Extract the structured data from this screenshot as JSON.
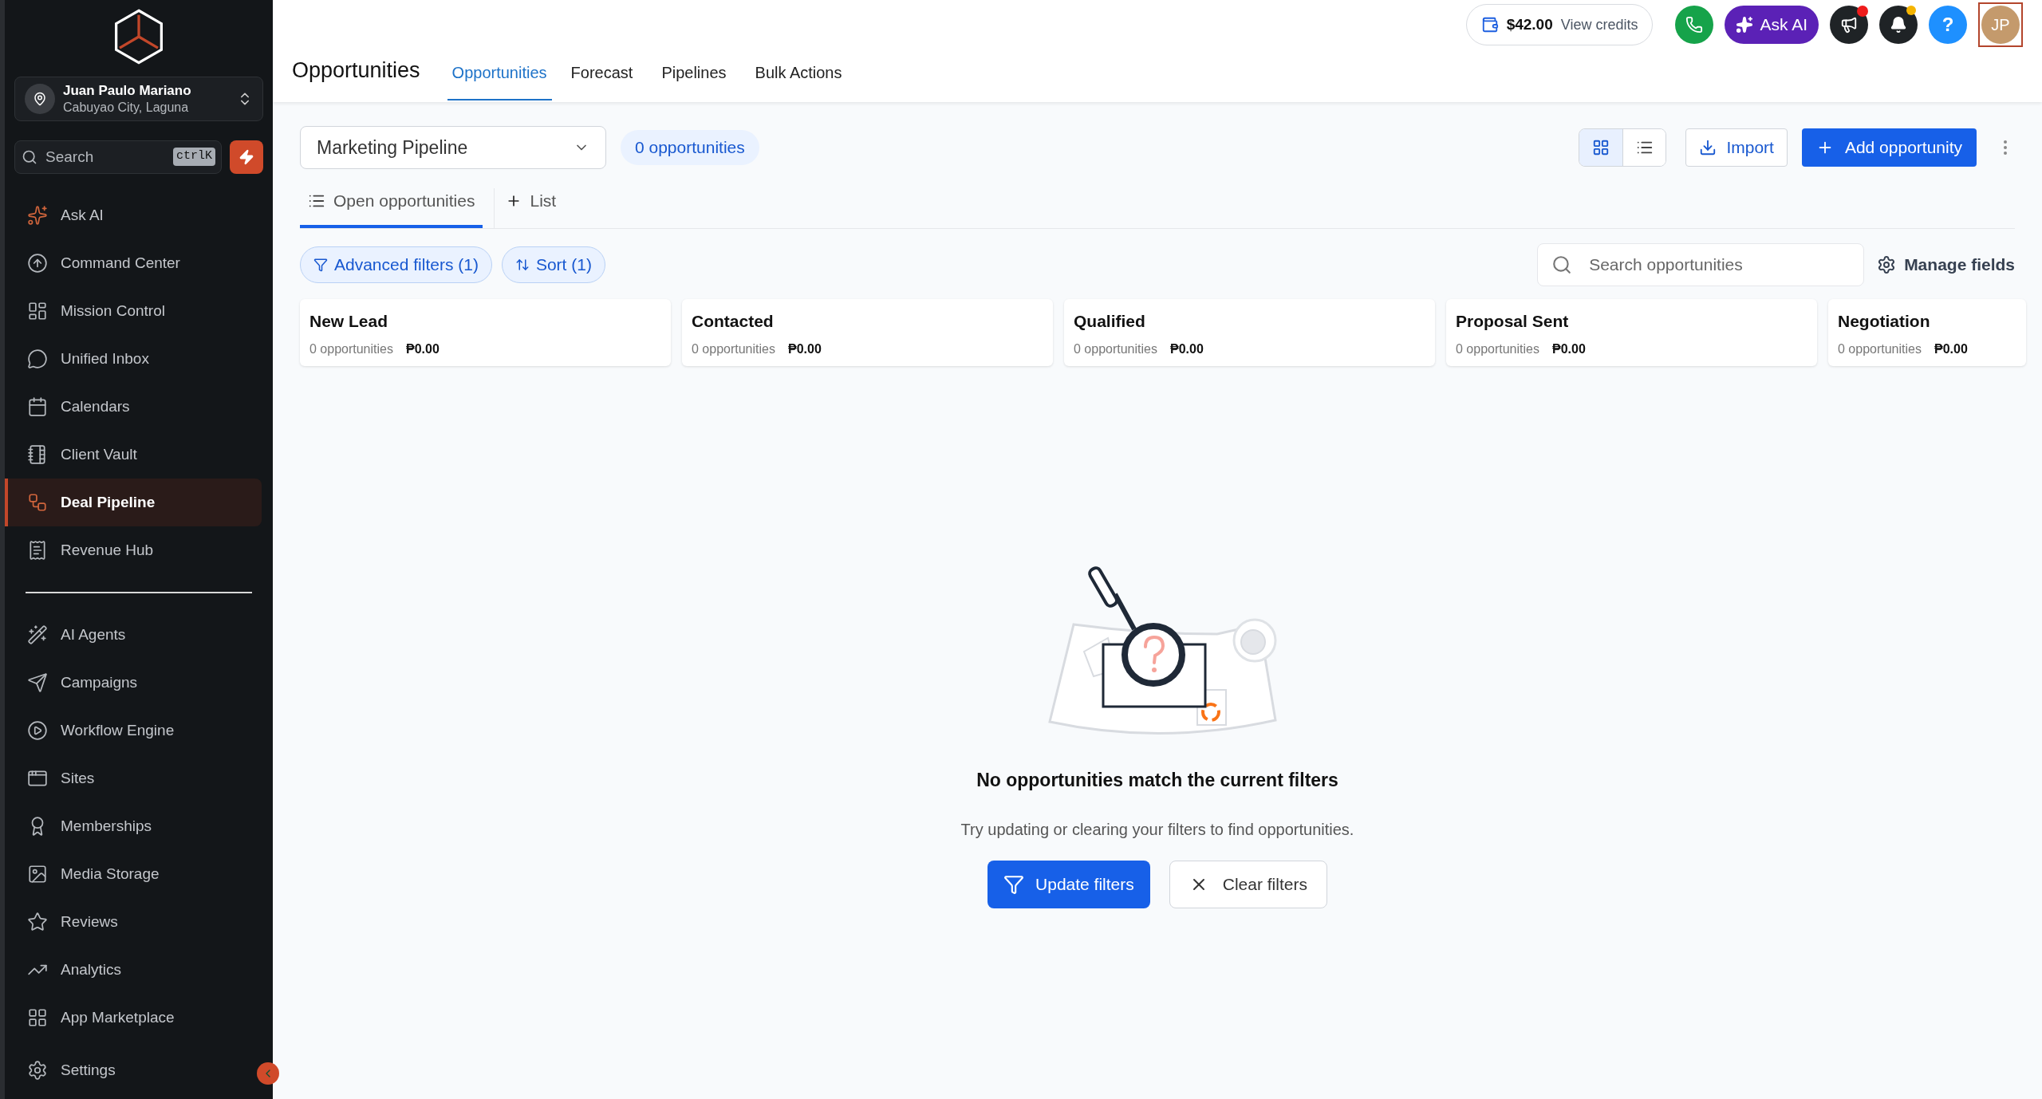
{
  "account": {
    "name": "Juan Paulo Mariano",
    "location": "Cabuyao City, Laguna"
  },
  "sidebar_search": {
    "placeholder": "Search",
    "shortcut": "ctrlK"
  },
  "nav_groups": [
    {
      "items": [
        {
          "label": "Ask AI",
          "selected": false
        },
        {
          "label": "Command Center",
          "selected": false
        },
        {
          "label": "Mission Control",
          "selected": false
        },
        {
          "label": "Unified Inbox",
          "selected": false
        },
        {
          "label": "Calendars",
          "selected": false
        },
        {
          "label": "Client Vault",
          "selected": false
        },
        {
          "label": "Deal Pipeline",
          "selected": true
        },
        {
          "label": "Revenue Hub",
          "selected": false
        }
      ]
    },
    {
      "items": [
        {
          "label": "AI Agents",
          "selected": false
        },
        {
          "label": "Campaigns",
          "selected": false
        },
        {
          "label": "Workflow Engine",
          "selected": false
        },
        {
          "label": "Sites",
          "selected": false
        },
        {
          "label": "Memberships",
          "selected": false
        },
        {
          "label": "Media Storage",
          "selected": false
        },
        {
          "label": "Reviews",
          "selected": false
        },
        {
          "label": "Analytics",
          "selected": false
        },
        {
          "label": "App Marketplace",
          "selected": false
        }
      ]
    }
  ],
  "settings": {
    "label": "Settings"
  },
  "topbar": {
    "credits": "$42.00",
    "credits_link": "View credits",
    "ask_ai": "Ask AI",
    "announcements_unread": true,
    "notifications_unread": true,
    "help": "?",
    "avatar": "JP"
  },
  "page": {
    "title": "Opportunities",
    "tabs": [
      {
        "label": "Opportunities",
        "selected": true
      },
      {
        "label": "Forecast",
        "selected": false
      },
      {
        "label": "Pipelines",
        "selected": false
      },
      {
        "label": "Bulk Actions",
        "selected": false
      }
    ]
  },
  "pipeline": {
    "value": "Marketing Pipeline",
    "count": "0 opportunities"
  },
  "views": [
    {
      "kind": "board",
      "selected": true
    },
    {
      "kind": "list",
      "selected": false
    }
  ],
  "import": "Import",
  "add": "Add opportunity",
  "list_tabs": [
    {
      "label": "Open opportunities",
      "selected": true
    }
  ],
  "add_list": "List",
  "filters": [
    {
      "kind": "filter",
      "label": "Advanced filters (1)"
    },
    {
      "kind": "sort",
      "label": "Sort (1)"
    }
  ],
  "search": {
    "placeholder": "Search opportunities"
  },
  "manage_fields": "Manage fields",
  "stages": [
    {
      "name": "New Lead",
      "count": "0 opportunities",
      "amount": "₱0.00"
    },
    {
      "name": "Contacted",
      "count": "0 opportunities",
      "amount": "₱0.00"
    },
    {
      "name": "Qualified",
      "count": "0 opportunities",
      "amount": "₱0.00"
    },
    {
      "name": "Proposal Sent",
      "count": "0 opportunities",
      "amount": "₱0.00"
    },
    {
      "name": "Negotiation",
      "count": "0 opportunities",
      "amount": "₱0.00"
    }
  ],
  "empty": {
    "title": "No opportunities match the current filters",
    "message": "Try updating or clearing your filters to find opportunities.",
    "primary": "Update filters",
    "secondary": "Clear filters"
  }
}
